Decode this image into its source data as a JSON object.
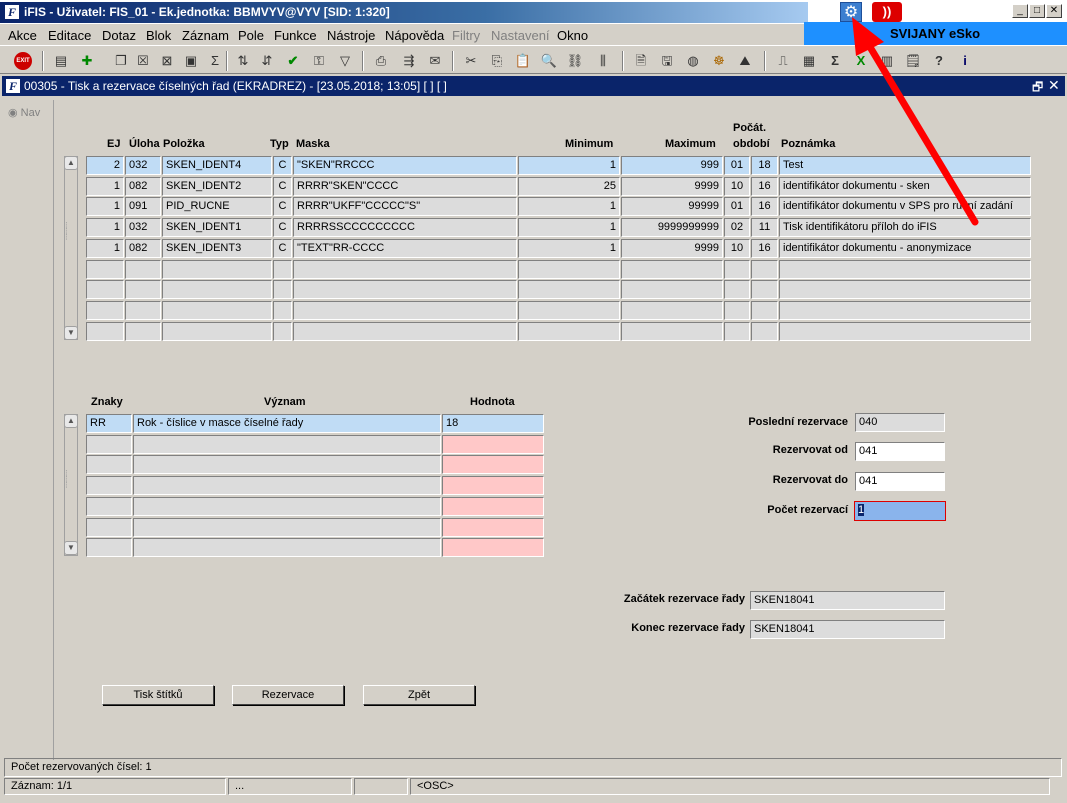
{
  "app": {
    "title": "iFIS - Uživatel: FIS_01 - Ek.jednotka: BBMVYV@VYV   [SID: 1:320]",
    "brand": "SVIJANY eSko",
    "window_title": "00305 - Tisk a rezervace číselných řad (EKRADREZ) - [23.05.2018; 13:05]  [ ]  [ ]",
    "nav_label": "Nav"
  },
  "menu": [
    "Akce",
    "Editace",
    "Dotaz",
    "Blok",
    "Záznam",
    "Pole",
    "Funkce",
    "Nástroje",
    "Nápověda",
    "Filtry",
    "Nastavení",
    "Okno"
  ],
  "toolbar": {
    "exit_label": "EXIT",
    "icons": [
      "insert-record-icon",
      "add-record-icon",
      "duplicate-icon",
      "delete-icon",
      "sort-asc-icon",
      "sort-desc-icon",
      "confirm-icon",
      "search-icon",
      "filter-icon",
      "print-icon",
      "export-icon",
      "mail-icon",
      "cut-icon",
      "copy-icon",
      "paste-icon",
      "zoom-icon",
      "link-icon",
      "refresh-icon",
      "columns-icon",
      "open-doc-icon",
      "save-doc-icon",
      "globe-icon",
      "settings-wheel-icon",
      "mountain-icon",
      "chart-icon",
      "document-icon",
      "sum-icon",
      "excel-icon",
      "calendar-icon",
      "help-icon",
      "info-icon"
    ]
  },
  "grid1": {
    "headers": {
      "ej": "EJ",
      "uloha": "Úloha",
      "polozka": "Položka",
      "typ": "Typ",
      "maska": "Maska",
      "minimum": "Minimum",
      "maximum": "Maximum",
      "pocat_obdobi_1": "Počát.",
      "pocat_obdobi_2": "období",
      "poznamka": "Poznámka"
    },
    "rows": [
      {
        "ej": "2",
        "uloha": "032",
        "polozka": "SKEN_IDENT4",
        "typ": "C",
        "maska": "\"SKEN\"RRCCC",
        "minimum": "1",
        "maximum": "999",
        "obdobi": "01",
        "obdobi2": "18",
        "poznamka": "Test"
      },
      {
        "ej": "1",
        "uloha": "082",
        "polozka": "SKEN_IDENT2",
        "typ": "C",
        "maska": "RRRR\"SKEN\"CCCC",
        "minimum": "25",
        "maximum": "9999",
        "obdobi": "10",
        "obdobi2": "16",
        "poznamka": "identifikátor dokumentu - sken"
      },
      {
        "ej": "1",
        "uloha": "091",
        "polozka": "PID_RUCNE",
        "typ": "C",
        "maska": "RRRR\"UKFF\"CCCCC\"S\"",
        "minimum": "1",
        "maximum": "99999",
        "obdobi": "01",
        "obdobi2": "16",
        "poznamka": "identifikátor dokumentu v SPS pro ruční zadání"
      },
      {
        "ej": "1",
        "uloha": "032",
        "polozka": "SKEN_IDENT1",
        "typ": "C",
        "maska": "RRRRSSCCCCCCCCC",
        "minimum": "1",
        "maximum": "9999999999",
        "obdobi": "02",
        "obdobi2": "11",
        "poznamka": "Tisk identifikátoru příloh do iFIS"
      },
      {
        "ej": "1",
        "uloha": "082",
        "polozka": "SKEN_IDENT3",
        "typ": "C",
        "maska": "\"TEXT\"RR-CCCC",
        "minimum": "1",
        "maximum": "9999",
        "obdobi": "10",
        "obdobi2": "16",
        "poznamka": "identifikátor dokumentu - anonymizace"
      },
      {
        "ej": "",
        "uloha": "",
        "polozka": "",
        "typ": "",
        "maska": "",
        "minimum": "",
        "maximum": "",
        "obdobi": "",
        "obdobi2": "",
        "poznamka": ""
      },
      {
        "ej": "",
        "uloha": "",
        "polozka": "",
        "typ": "",
        "maska": "",
        "minimum": "",
        "maximum": "",
        "obdobi": "",
        "obdobi2": "",
        "poznamka": ""
      },
      {
        "ej": "",
        "uloha": "",
        "polozka": "",
        "typ": "",
        "maska": "",
        "minimum": "",
        "maximum": "",
        "obdobi": "",
        "obdobi2": "",
        "poznamka": ""
      },
      {
        "ej": "",
        "uloha": "",
        "polozka": "",
        "typ": "",
        "maska": "",
        "minimum": "",
        "maximum": "",
        "obdobi": "",
        "obdobi2": "",
        "poznamka": ""
      }
    ]
  },
  "grid2": {
    "headers": {
      "znaky": "Znaky",
      "vyznam": "Význam",
      "hodnota": "Hodnota"
    },
    "rows": [
      {
        "znaky": "RR",
        "vyznam": "Rok - číslice v masce číselné řady",
        "hodnota": "18"
      },
      {
        "znaky": "",
        "vyznam": "",
        "hodnota": ""
      },
      {
        "znaky": "",
        "vyznam": "",
        "hodnota": ""
      },
      {
        "znaky": "",
        "vyznam": "",
        "hodnota": ""
      },
      {
        "znaky": "",
        "vyznam": "",
        "hodnota": ""
      },
      {
        "znaky": "",
        "vyznam": "",
        "hodnota": ""
      },
      {
        "znaky": "",
        "vyznam": "",
        "hodnota": ""
      }
    ]
  },
  "form": {
    "posledni_rezervace_label": "Poslední rezervace",
    "posledni_rezervace": "040",
    "rezervovat_od_label": "Rezervovat od",
    "rezervovat_od": "041",
    "rezervovat_do_label": "Rezervovat do",
    "rezervovat_do": "041",
    "pocet_rezervaci_label": "Počet rezervací",
    "pocet_rezervaci": "1",
    "zacatek_label": "Začátek rezervace řady",
    "zacatek": "SKEN18041",
    "konec_label": "Konec rezervace řady",
    "konec": "SKEN18041"
  },
  "buttons": {
    "tisk": "Tisk štítků",
    "rezervace": "Rezervace",
    "zpet": "Zpět"
  },
  "status": {
    "message": "Počet rezervovaných čísel: 1",
    "record": "Záznam: 1/1",
    "ellipsis": "...",
    "mode": "<OSC>"
  },
  "colors": {
    "accent_arrow": "#ff0000",
    "selected_row": "#c0dcf5",
    "required_field": "#ffc8c8"
  }
}
